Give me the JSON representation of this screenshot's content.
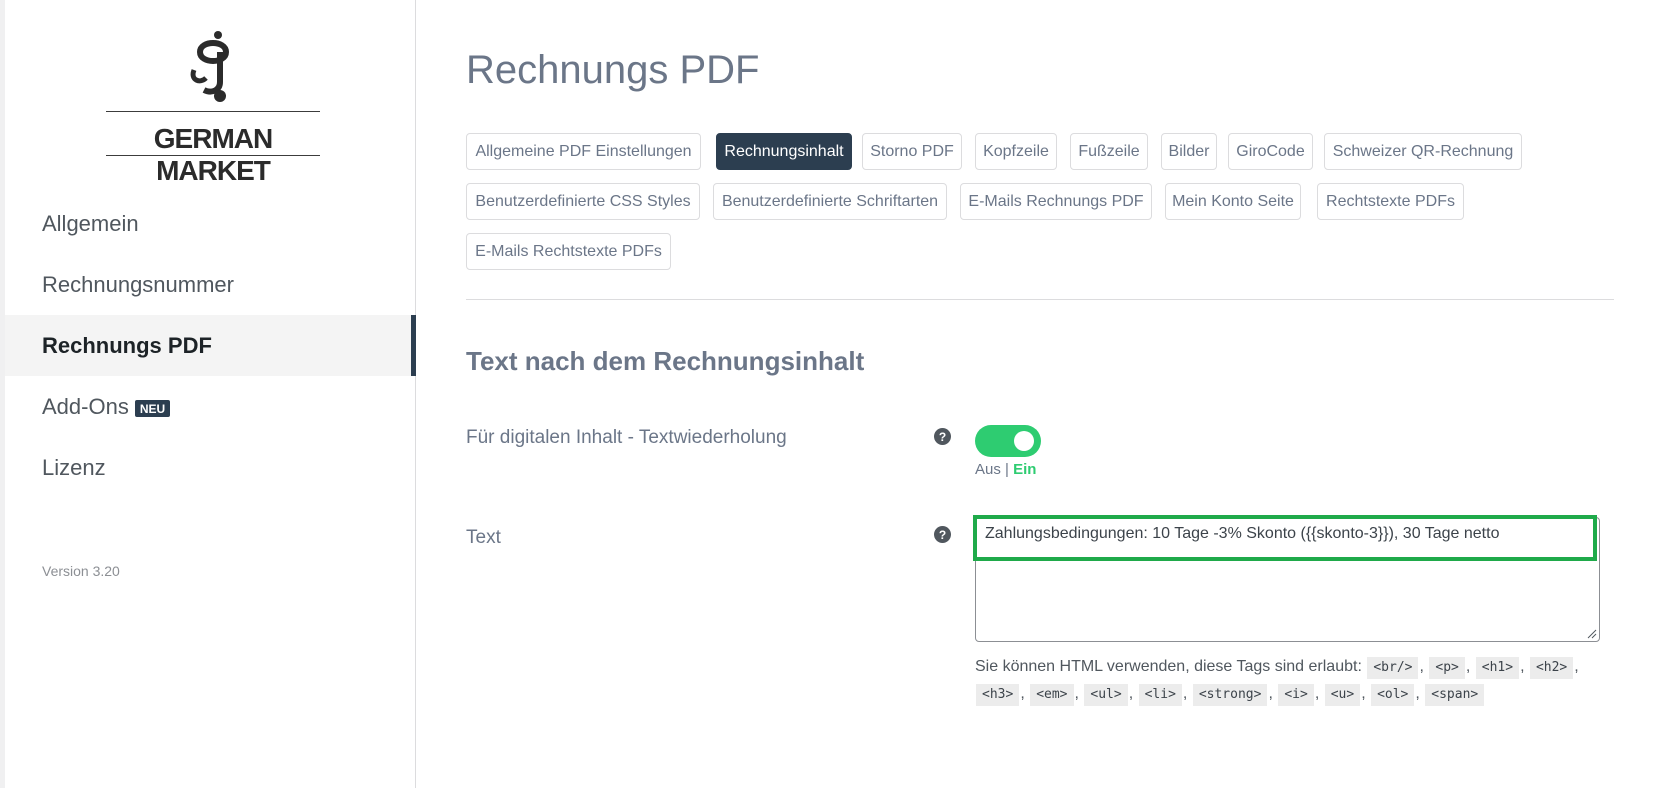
{
  "brand": {
    "name": "GERMAN MARKET"
  },
  "sidebar": {
    "items": [
      {
        "label": "Allgemein"
      },
      {
        "label": "Rechnungsnummer"
      },
      {
        "label": "Rechnungs PDF"
      },
      {
        "label": "Add-Ons",
        "badge": "NEU"
      },
      {
        "label": "Lizenz"
      }
    ],
    "active_index": 2,
    "version": "Version 3.20"
  },
  "main": {
    "title": "Rechnungs PDF",
    "tabs": [
      "Allgemeine PDF Einstellungen",
      "Rechnungsinhalt",
      "Storno PDF",
      "Kopfzeile",
      "Fußzeile",
      "Bilder",
      "GiroCode",
      "Schweizer QR-Rechnung",
      "Benutzerdefinierte CSS Styles",
      "Benutzerdefinierte Schriftarten",
      "E-Mails Rechnungs PDF",
      "Mein Konto Seite",
      "Rechtstexte PDFs",
      "E-Mails Rechtstexte PDFs"
    ],
    "active_tab": "Rechnungsinhalt",
    "section_title": "Text nach dem Rechnungsinhalt",
    "fields": {
      "digital": {
        "label": "Für digitalen Inhalt - Textwiederholung",
        "toggle_off": "Aus",
        "toggle_separator": "|",
        "toggle_on": "Ein",
        "value": true
      },
      "text": {
        "label": "Text",
        "value": "Zahlungsbedingungen: 10 Tage -3% Skonto ({{skonto-3}}), 30 Tage netto",
        "hint": "Sie können HTML verwenden, diese Tags sind erlaubt:",
        "allowed_tags": [
          "<br/>",
          "<p>",
          "<h1>",
          "<h2>",
          "<h3>",
          "<em>",
          "<ul>",
          "<li>",
          "<strong>",
          "<i>",
          "<u>",
          "<ol>",
          "<span>"
        ]
      }
    },
    "help_glyph": "?"
  },
  "colors": {
    "accent_dark": "#2c3e50",
    "toggle_on": "#2ecc71",
    "highlight": "#1faa4a"
  }
}
